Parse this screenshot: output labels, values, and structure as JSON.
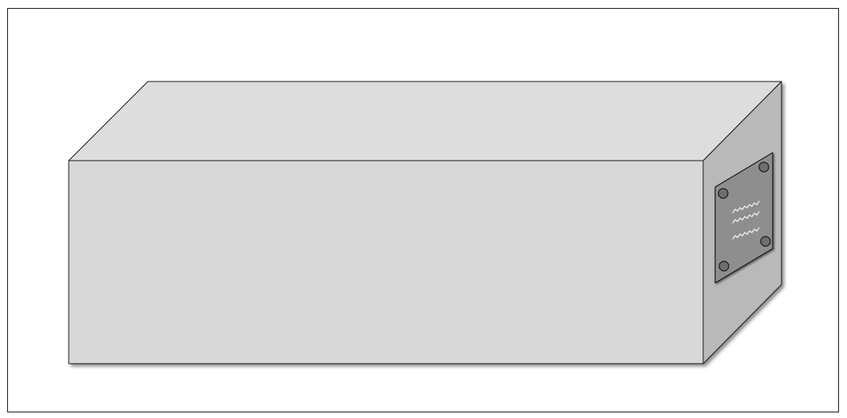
{
  "diagram": {
    "subject": "3d-box-with-end-plate",
    "colors": {
      "background": "#ffffff",
      "frame": "#1a1a1a",
      "top_face": "#dddddd",
      "front_face": "#d8d8d8",
      "side_face": "#b9b9b9",
      "plate": "#8e8e8e",
      "bolt": "#6e6e6e",
      "wave": "#e8e8e8",
      "outline": "#1a1a1a"
    },
    "plate": {
      "bolt_count": 4,
      "wave_lines": 3
    }
  }
}
